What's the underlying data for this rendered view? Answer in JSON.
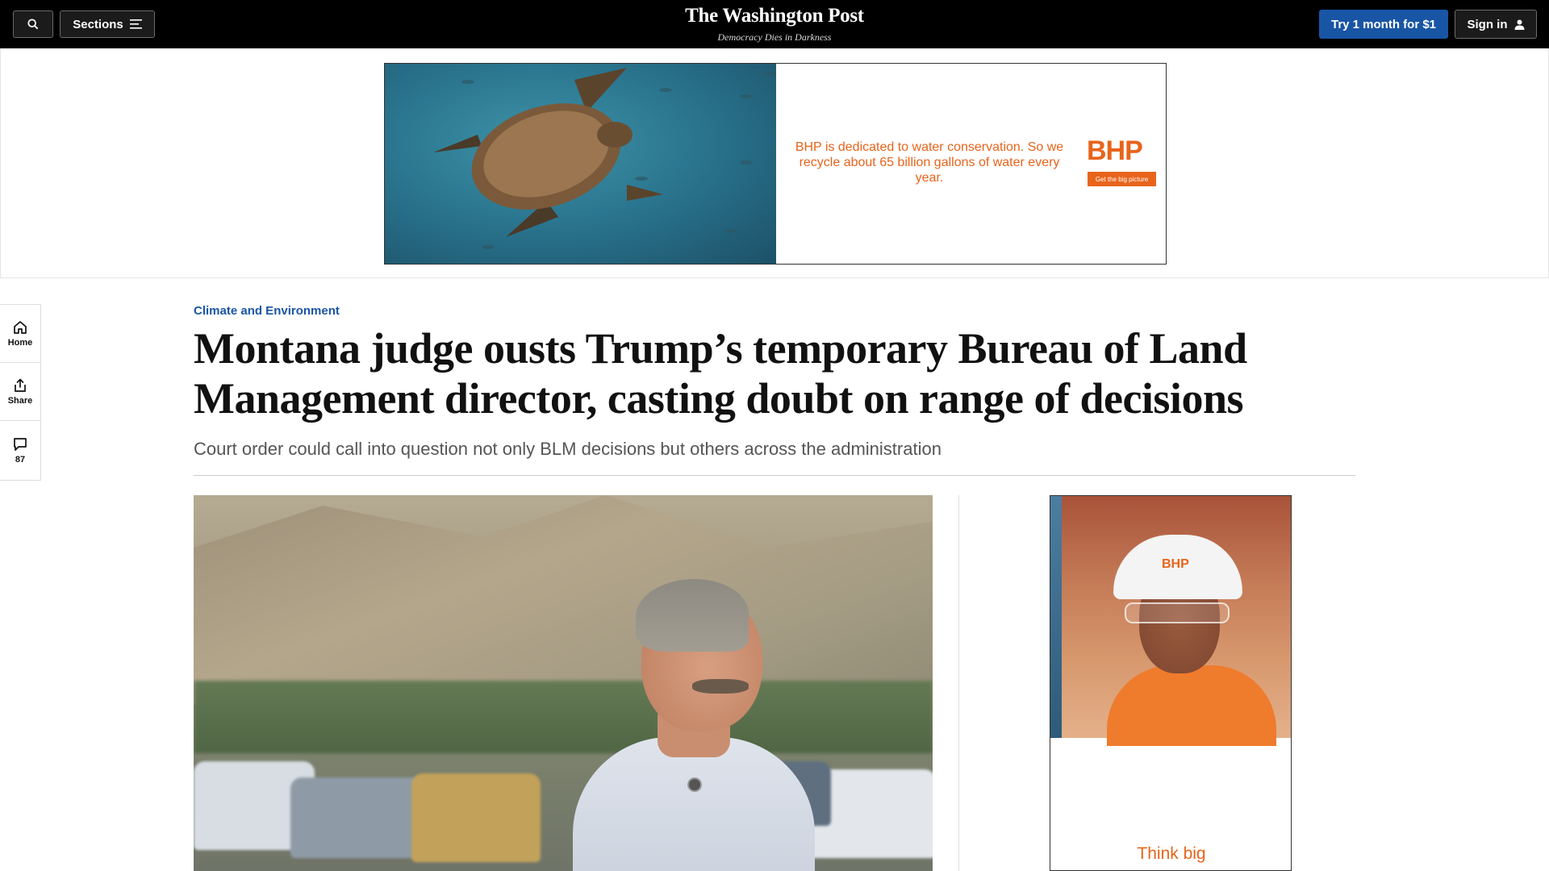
{
  "header": {
    "search_icon": "search-icon",
    "sections_label": "Sections",
    "logo": "The Washington Post",
    "tagline": "Democracy Dies in Darkness",
    "subscribe_label": "Try 1 month for $1",
    "signin_label": "Sign in"
  },
  "top_ad": {
    "copy": "BHP is dedicated to water conservation. So we recycle about 65 billion gallons of water every year.",
    "brand": "BHP",
    "cta": "Get the big picture"
  },
  "rail": {
    "home_label": "Home",
    "share_label": "Share",
    "comments_count": "87"
  },
  "article": {
    "section": "Climate and Environment",
    "headline": "Montana judge ousts Trump’s temporary Bureau of Land Management director, casting doubt on range of decisions",
    "dek": "Court order could call into question not only BLM decisions but others across the administration"
  },
  "side_ad": {
    "hat_brand": "BHP",
    "slogan": "Think big"
  },
  "colors": {
    "accent_blue": "#1955a5",
    "bhp_orange": "#e8641b",
    "topbar": "#000000"
  }
}
